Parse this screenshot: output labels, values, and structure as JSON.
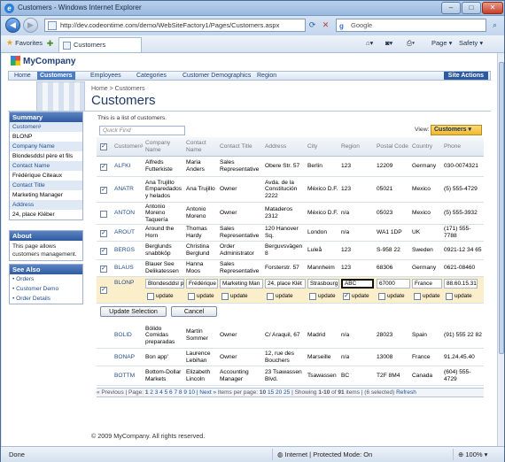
{
  "browser": {
    "title": "Customers - Windows Internet Explorer",
    "url": "http://dev.codeontime.com/demo/WebSiteFactory1/Pages/Customers.aspx",
    "search_provider": "Google",
    "favorites_label": "Favorites",
    "tab_title": "Customers",
    "commands": {
      "page": "Page",
      "safety": "Safety"
    },
    "status_done": "Done",
    "status_zone": "Internet | Protected Mode: On",
    "zoom": "100%"
  },
  "app": {
    "logo": "MyCompany",
    "menu": [
      "Home",
      "Customers",
      "Employees",
      "Categories",
      "Customer Demographics",
      "Region"
    ],
    "site_actions": "Site Actions",
    "breadcrumb": "Home > Customers",
    "page_title": "Customers",
    "footer": "© 2009 MyCompany. All rights reserved."
  },
  "sidebar": {
    "summary": {
      "title": "Summary",
      "fields": [
        {
          "label": "Customer#",
          "value": "BLONP"
        },
        {
          "label": "Company Name",
          "value": "Blondesddsl père et fils"
        },
        {
          "label": "Contact Name",
          "value": "Frédérique Citeaux"
        },
        {
          "label": "Contact Title",
          "value": "Marketing Manager"
        },
        {
          "label": "Address",
          "value": "24, place Kléber"
        }
      ]
    },
    "about": {
      "title": "About",
      "text": "This page allows customers management."
    },
    "see_also": {
      "title": "See Also",
      "links": [
        "Orders",
        "Customer Demo",
        "Order Details"
      ]
    }
  },
  "grid": {
    "description": "This is a list of customers.",
    "quick_find": "Quick Find",
    "views_label": "View:",
    "view_selected": "Customers",
    "columns": [
      "Customer#",
      "Company Name",
      "Contact Name",
      "Contact Title",
      "Address",
      "City",
      "Region",
      "Postal Code",
      "Country",
      "Phone"
    ],
    "rows_top": [
      {
        "checked": true,
        "id": "ALFKI",
        "company": "Alfreds Futterkiste",
        "contact": "Maria Anders",
        "title": "Sales Representative",
        "address": "Obere Str. 57",
        "city": "Berlin",
        "region": "123",
        "postal": "12209",
        "country": "Germany",
        "phone": "030-0074321"
      },
      {
        "checked": true,
        "id": "ANATR",
        "company": "Ana Trujillo Emparedados y helados",
        "contact": "Ana Trujillo",
        "title": "Owner",
        "address": "Avda. de la Constitución 2222",
        "city": "México D.F.",
        "region": "123",
        "postal": "05021",
        "country": "Mexico",
        "phone": "(5) 555-4729"
      },
      {
        "checked": false,
        "id": "ANTON",
        "company": "Antonio Moreno Taquería",
        "contact": "Antonio Moreno",
        "title": "Owner",
        "address": "Mataderos 2312",
        "city": "México D.F.",
        "region": "n/a",
        "postal": "05023",
        "country": "Mexico",
        "phone": "(5) 555-3932"
      },
      {
        "checked": true,
        "id": "AROUT",
        "company": "Around the Horn",
        "contact": "Thomas Hardy",
        "title": "Sales Representative",
        "address": "120 Hanover Sq.",
        "city": "London",
        "region": "n/a",
        "postal": "WA1 1DP",
        "country": "UK",
        "phone": "(171) 555-7788"
      },
      {
        "checked": true,
        "id": "BERGS",
        "company": "Berglunds snabbköp",
        "contact": "Christina Berglund",
        "title": "Order Administrator",
        "address": "Berguvsvägen 8",
        "city": "Luleå",
        "region": "123",
        "postal": "S-958 22",
        "country": "Sweden",
        "phone": "0921-12 34 65"
      },
      {
        "checked": true,
        "id": "BLAUS",
        "company": "Blauer See Delikatessen",
        "contact": "Hanna Moos",
        "title": "Sales Representative",
        "address": "Forsterstr. 57",
        "city": "Mannheim",
        "region": "123",
        "postal": "68306",
        "country": "Germany",
        "phone": "0621-08460"
      }
    ],
    "edit_row": {
      "checked": true,
      "id": "BLONP",
      "values": [
        "Blondesddsl père",
        "Frédérique Cit",
        "Marketing Man",
        "24, place Klét",
        "Strasbourg",
        "ABC",
        "67000",
        "France",
        "88.60.15.31"
      ],
      "update_label": "update"
    },
    "buttons": {
      "update_selection": "Update Selection",
      "cancel": "Cancel"
    },
    "rows_bottom": [
      {
        "id": "BOLID",
        "company": "Bólido Comidas preparadas",
        "contact": "Martín Sommer",
        "title": "Owner",
        "address": "C/ Araquil, 67",
        "city": "Madrid",
        "region": "n/a",
        "postal": "28023",
        "country": "Spain",
        "phone": "(91) 555 22 82"
      },
      {
        "id": "BONAP",
        "company": "Bon app'",
        "contact": "Laurence Lebihan",
        "title": "Owner",
        "address": "12, rue des Bouchers",
        "city": "Marseille",
        "region": "n/a",
        "postal": "13008",
        "country": "France",
        "phone": "91.24.45.40"
      },
      {
        "id": "BOTTM",
        "company": "Bottom-Dollar Markets",
        "contact": "Elizabeth Lincoln",
        "title": "Accounting Manager",
        "address": "23 Tsawassen Blvd.",
        "city": "Tsawassen",
        "region": "BC",
        "postal": "T2F 8M4",
        "country": "Canada",
        "phone": "(604) 555-4729"
      }
    ],
    "pager": {
      "previous": "« Previous",
      "page_label": "| Page:",
      "pages": [
        "1",
        "2",
        "3",
        "4",
        "5",
        "6",
        "7",
        "8",
        "9",
        "10"
      ],
      "next": "| Next »",
      "items_per_page_label": "Items per page:",
      "page_sizes": [
        "10",
        "15",
        "20",
        "25"
      ],
      "showing_prefix": "| Showing",
      "showing_range": "1-10",
      "showing_of": "of",
      "total": "91",
      "items_label": "items |",
      "selected_info": "(6 selected)",
      "refresh": "Refresh"
    }
  }
}
